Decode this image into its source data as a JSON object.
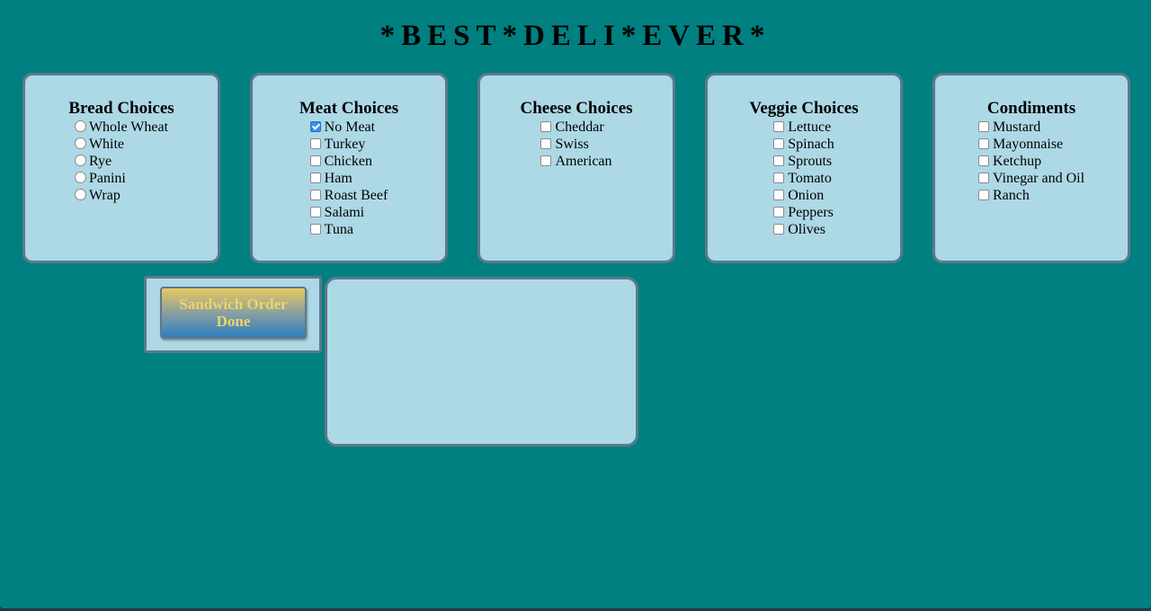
{
  "title": "*BEST*DELI*EVER*",
  "panels": {
    "bread": {
      "heading": "Bread Choices",
      "input_type": "radio",
      "options": [
        "Whole Wheat",
        "White",
        "Rye",
        "Panini",
        "Wrap"
      ]
    },
    "meat": {
      "heading": "Meat Choices",
      "input_type": "checkbox",
      "options": [
        "No Meat",
        "Turkey",
        "Chicken",
        "Ham",
        "Roast Beef",
        "Salami",
        "Tuna"
      ],
      "checked": [
        "No Meat"
      ]
    },
    "cheese": {
      "heading": "Cheese Choices",
      "input_type": "checkbox",
      "options": [
        "Cheddar",
        "Swiss",
        "American"
      ],
      "checked": []
    },
    "veggie": {
      "heading": "Veggie Choices",
      "input_type": "checkbox",
      "options": [
        "Lettuce",
        "Spinach",
        "Sprouts",
        "Tomato",
        "Onion",
        "Peppers",
        "Olives"
      ],
      "checked": []
    },
    "condiments": {
      "heading": "Condiments",
      "input_type": "checkbox",
      "options": [
        "Mustard",
        "Mayonnaise",
        "Ketchup",
        "Vinegar and Oil",
        "Ranch"
      ],
      "checked": []
    }
  },
  "order_button": {
    "label": "Sandwich Order Done"
  },
  "output": {
    "text": ""
  },
  "colors": {
    "page_background": "#008080",
    "panel_background": "#add8e6",
    "panel_border": "#5a7a8c",
    "button_text": "#f2d36b"
  }
}
